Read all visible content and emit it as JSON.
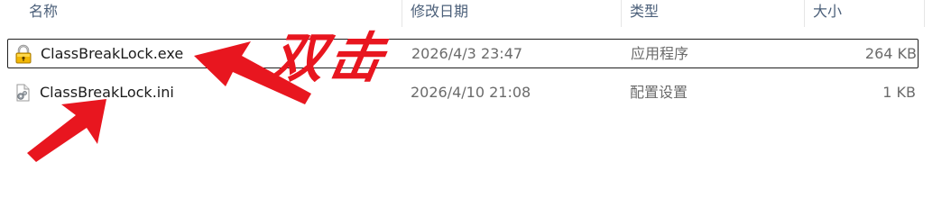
{
  "columns": {
    "name": "名称",
    "modified": "修改日期",
    "type": "类型",
    "size": "大小"
  },
  "files": [
    {
      "name": "ClassBreakLock.exe",
      "modified": "2026/4/3 23:47",
      "type": "应用程序",
      "size": "264 KB",
      "icon": "lock-icon",
      "selected": true
    },
    {
      "name": "ClassBreakLock.ini",
      "modified": "2026/4/10 21:08",
      "type": "配置设置",
      "size": "1 KB",
      "icon": "settings-file-icon",
      "selected": false
    }
  ],
  "annotation": {
    "text": "双击",
    "color": "#e8161f"
  }
}
